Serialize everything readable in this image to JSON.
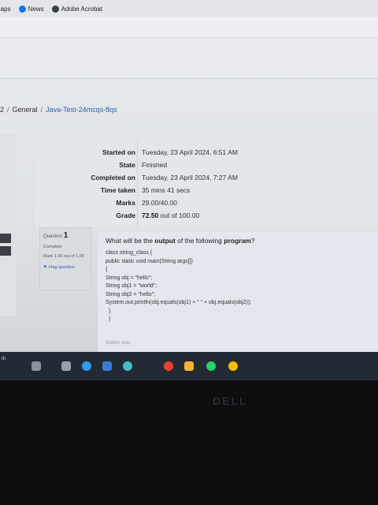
{
  "bookmarks": [
    {
      "label": "Maps",
      "icon": "maps-icon",
      "color": "#4caf50"
    },
    {
      "label": "News",
      "icon": "news-icon",
      "color": "#1a73e8"
    },
    {
      "label": "Adobe Acrobat",
      "icon": "adobe-acrobat-icon",
      "color": "#b30b00"
    }
  ],
  "breadcrumb": {
    "prefix": "2",
    "sep": "/",
    "general": "General",
    "quiz": "Java-Test-24mcqs-8qs"
  },
  "summary": [
    {
      "label": "Started on",
      "value": "Tuesday, 23 April 2024, 6:51 AM"
    },
    {
      "label": "State",
      "value": "Finished"
    },
    {
      "label": "Completed on",
      "value": "Tuesday, 23 April 2024, 7:27 AM"
    },
    {
      "label": "Time taken",
      "value": "35 mins 41 secs"
    },
    {
      "label": "Marks",
      "value": "29.00/40.00"
    },
    {
      "label": "Grade",
      "value_bold": "72.50",
      "value_rest": "out of 100.00"
    }
  ],
  "question_info": {
    "question_label": "Question",
    "number": "1",
    "status": "Complete",
    "mark": "Mark 1.00 out of 1.00",
    "flag": "Flag question"
  },
  "question": {
    "prompt_pre": "What will be the ",
    "prompt_bold1": "output",
    "prompt_mid": " of the following ",
    "prompt_bold2": "program",
    "prompt_post": "?",
    "code": [
      "class string_class {",
      "public static void main(String args[])",
      "{",
      "String obj = \"hello\";",
      "String obj1 = \"world\";",
      "String obj2 = \"hello\";",
      "System.out.println(obj.equals(obj1) + \" \" + obj.equals(obj2));",
      "}",
      "}"
    ],
    "select_one": "Select one:"
  },
  "taskbar": {
    "left_text": "th",
    "icons": [
      {
        "name": "search-icon",
        "color": "#8c939e"
      },
      {
        "name": "task-view-icon",
        "color": "#9aa1ab"
      },
      {
        "name": "edge-icon",
        "color": "#2d9bf0"
      },
      {
        "name": "store-icon",
        "color": "#3a7bd5"
      },
      {
        "name": "photos-icon",
        "color": "#3ec1c9"
      },
      {
        "name": "chrome-icon",
        "color": "#e94235"
      },
      {
        "name": "files-icon",
        "color": "#f2b233"
      },
      {
        "name": "whatsapp-icon",
        "color": "#25d366"
      },
      {
        "name": "chrome-2-icon",
        "color": "#fbbc05"
      }
    ]
  },
  "brand": "DELL"
}
